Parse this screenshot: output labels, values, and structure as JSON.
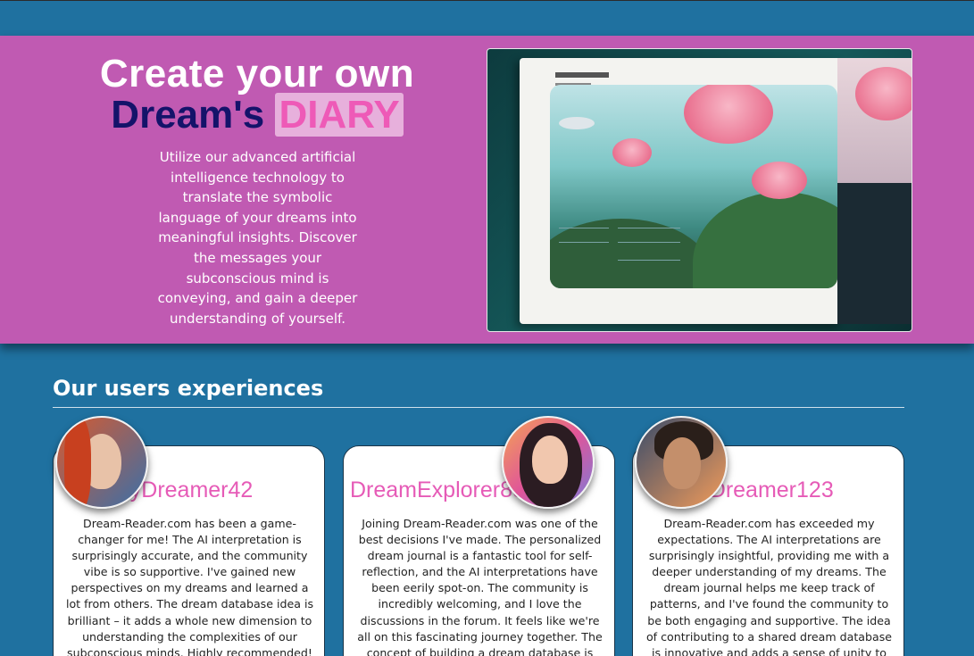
{
  "hero": {
    "title_line1": "Create your own",
    "title_line2_pre": "Dream's",
    "title_line2_highlight": "DIARY",
    "description": "Utilize our advanced artificial intelligence technology to translate the symbolic language of your dreams into meaningful insights. Discover the messages your subconscious mind is conveying, and gain a deeper understanding of yourself."
  },
  "testimonials_section": {
    "title": "Our users experiences",
    "cards": [
      {
        "name": "HappyDreamer42",
        "text": "Dream-Reader.com has been a game-changer for me! The AI interpretation is surprisingly accurate, and the community vibe is so supportive. I've gained new perspectives on my dreams and learned a lot from others. The dream database idea is brilliant – it adds a whole new dimension to understanding the complexities of our subconscious minds. Highly recommended!"
      },
      {
        "name": "DreamExplorer89",
        "text": "Joining Dream-Reader.com was one of the best decisions I've made. The personalized dream journal is a fantastic tool for self-reflection, and the AI interpretations have been eerily spot-on. The community is incredibly welcoming, and I love the discussions in the forum. It feels like we're all on this fascinating journey together. The concept of building a dream database is"
      },
      {
        "name": "LucidDreamer123",
        "text": "Dream-Reader.com has exceeded my expectations. The AI interpretations are surprisingly insightful, providing me with a deeper understanding of my dreams. The dream journal helps me keep track of patterns, and I've found the community to be both engaging and supportive. The idea of contributing to a shared dream database is innovative and adds a sense of unity to our"
      }
    ]
  },
  "colors": {
    "background": "#1f71a0",
    "hero": "#c05ab2",
    "accent_pink": "#e65bb7",
    "title_dark": "#14136a"
  }
}
